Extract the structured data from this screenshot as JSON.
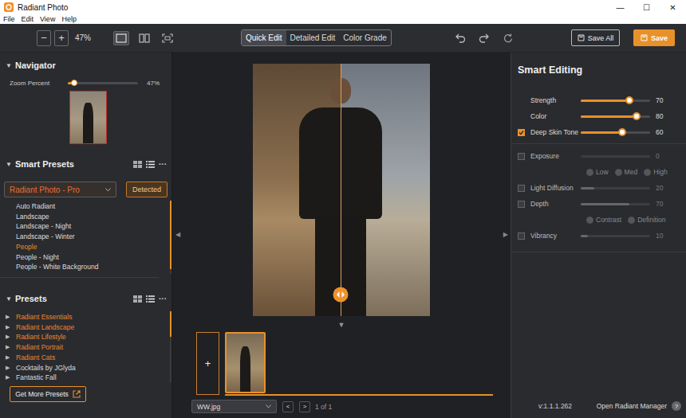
{
  "window": {
    "title": "Radiant Photo",
    "controls": [
      "—",
      "☐",
      "✕"
    ]
  },
  "menu": [
    "File",
    "Edit",
    "View",
    "Help"
  ],
  "toolbar": {
    "zoom_out": "−",
    "zoom_in": "+",
    "zoom": "47%",
    "views": [
      {
        "kind": "single",
        "selected": true
      },
      {
        "kind": "split",
        "selected": false
      },
      {
        "kind": "crop",
        "selected": false
      }
    ],
    "tabs": [
      {
        "label": "Quick Edit",
        "selected": true
      },
      {
        "label": "Detailed Edit",
        "selected": false
      },
      {
        "label": "Color Grade",
        "selected": false
      }
    ],
    "save_all": "Save All",
    "save": "Save"
  },
  "navigator": {
    "arrow": "▼",
    "title": "Navigator",
    "zoom_label": "Zoom Percent",
    "zoom_level": 0.09,
    "zoom_reading": "47%"
  },
  "smart_presets": {
    "arrow": "▼",
    "title": "Smart Presets",
    "more": "···",
    "collection": "Radiant Photo - Pro",
    "detected": "Detected",
    "items": [
      {
        "label": "Auto Radiant",
        "selected": false
      },
      {
        "label": "Landscape",
        "selected": false
      },
      {
        "label": "Landscape - Night",
        "selected": false
      },
      {
        "label": "Landscape - Winter",
        "selected": false
      },
      {
        "label": "People",
        "selected": true
      },
      {
        "label": "People - Night",
        "selected": false
      },
      {
        "label": "People - White Background",
        "selected": false
      }
    ]
  },
  "presets": {
    "arrow": "▼",
    "title": "Presets",
    "more": "···",
    "items": [
      {
        "arrow": "▶",
        "label": "Radiant Essentials",
        "highlighted": true
      },
      {
        "arrow": "▶",
        "label": "Radiant Landscape",
        "highlighted": true
      },
      {
        "arrow": "▶",
        "label": "Radiant Lifestyle",
        "highlighted": true
      },
      {
        "arrow": "▶",
        "label": "Radiant Portrait",
        "highlighted": true
      },
      {
        "arrow": "▶",
        "label": "Radiant Cats",
        "highlighted": true
      },
      {
        "arrow": "▶",
        "label": "Cocktails by JGlyda",
        "highlighted": false
      },
      {
        "arrow": "▶",
        "label": "Fantastic Fall",
        "highlighted": false
      }
    ],
    "get_more": "Get More Presets"
  },
  "canvas": {
    "prev_arrow": "◀",
    "next_arrow": "▶",
    "filmstrip_toggle": "▼",
    "add": "+",
    "file": "WW.jpg",
    "prev": "<",
    "next": ">",
    "page": "1 of 1"
  },
  "smart_editing": {
    "title": "Smart Editing",
    "groups": [
      {
        "rows": [
          {
            "kind": "slider",
            "label": "Strength",
            "level": 0.7,
            "reading": "70",
            "disabled": false
          },
          {
            "kind": "slider",
            "label": "Color",
            "level": 0.8,
            "reading": "80",
            "disabled": false
          },
          {
            "kind": "check-slider",
            "label": "Deep Skin Tone",
            "checked": true,
            "level": 0.6,
            "reading": "60",
            "disabled": false
          }
        ]
      },
      {
        "rows": [
          {
            "kind": "check-slider",
            "label": "Exposure",
            "checked": false,
            "level": 0,
            "reading": "0",
            "disabled": true
          },
          {
            "kind": "radios",
            "disabled": true,
            "options": [
              {
                "label": "Low",
                "selected": false
              },
              {
                "label": "Med",
                "selected": false
              },
              {
                "label": "High",
                "selected": false
              }
            ]
          },
          {
            "kind": "check-slider",
            "label": "Light Diffusion",
            "checked": false,
            "level": 0.2,
            "reading": "20",
            "disabled": true
          },
          {
            "kind": "check-slider",
            "label": "Depth",
            "checked": false,
            "level": 0.7,
            "reading": "70",
            "disabled": true
          },
          {
            "kind": "radios",
            "disabled": true,
            "options": [
              {
                "label": "Contrast",
                "selected": false
              },
              {
                "label": "Definition",
                "selected": false
              }
            ]
          },
          {
            "kind": "check-slider",
            "label": "Vibrancy",
            "checked": false,
            "level": 0.1,
            "reading": "10",
            "disabled": true
          }
        ]
      }
    ],
    "version": "v:1.1.1.262",
    "manager": "Open Radiant Manager",
    "help": "?"
  }
}
